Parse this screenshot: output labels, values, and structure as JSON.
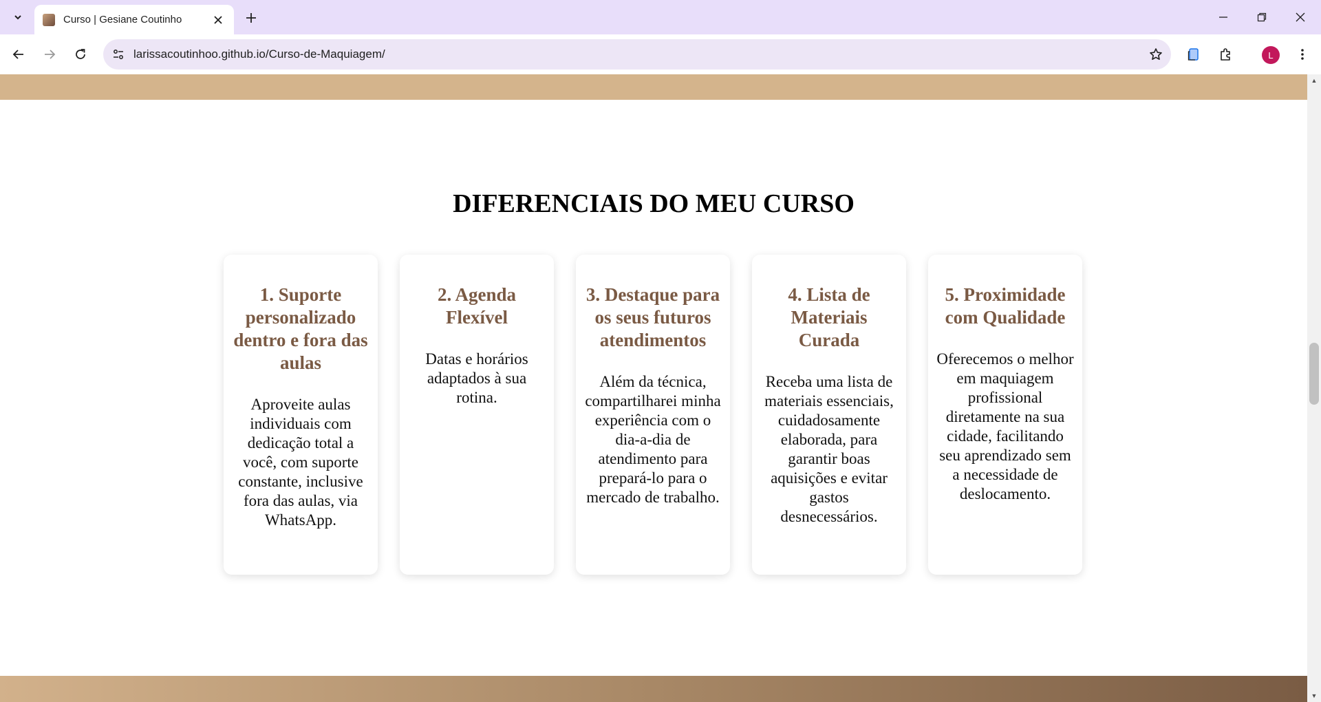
{
  "browser": {
    "tab_title": "Curso | Gesiane Coutinho",
    "url": "larissacoutinhoo.github.io/Curso-de-Maquiagem/",
    "profile_initial": "L",
    "icons": [
      "tab-search-icon",
      "close-icon",
      "plus-icon",
      "minimize-icon",
      "restore-icon",
      "window-close-icon",
      "back-icon",
      "forward-icon",
      "reload-icon",
      "site-info-icon",
      "star-icon",
      "reading-list-icon",
      "extensions-icon",
      "more-menu-icon"
    ]
  },
  "page": {
    "section_title": "DIFERENCIAIS DO MEU CURSO",
    "cards": [
      {
        "title": "1. Suporte personalizado dentro e fora das aulas",
        "text": "Aproveite aulas individuais com dedicação total a você, com suporte constante, inclusive fora das aulas, via WhatsApp."
      },
      {
        "title": "2. Agenda Flexível",
        "text": "Datas e horários adaptados à sua rotina."
      },
      {
        "title": "3. Destaque para os seus futuros atendimentos",
        "text": "Além da técnica, compartilharei minha experiência com o dia-a-dia de atendimento para prepará-lo para o mercado de trabalho."
      },
      {
        "title": "4. Lista de Materiais Curada",
        "text": "Receba uma lista de materiais essenciais, cuidadosamente elaborada, para garantir boas aquisições e evitar gastos desnecessários."
      },
      {
        "title": "5. Proximidade com Qualidade",
        "text": "Oferecemos o melhor em maquiagem profissional diretamente na sua cidade, facilitando seu aprendizado sem a necessidade de deslocamento."
      }
    ]
  },
  "colors": {
    "top_band": "#d4b48c",
    "card_title": "#7a5a44",
    "tabbar": "#e8defa",
    "avatar": "#c2185b"
  }
}
